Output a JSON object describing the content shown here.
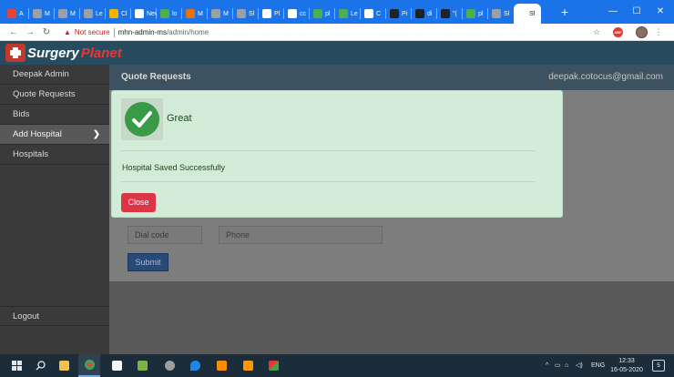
{
  "browser": {
    "tabs": [
      {
        "label": "A",
        "color": "#ea4335"
      },
      {
        "label": "M",
        "color": "#9aa0a6"
      },
      {
        "label": "M",
        "color": "#9aa0a6"
      },
      {
        "label": "Le",
        "color": "#9aa0a6"
      },
      {
        "label": "Cl",
        "color": "#f4b400"
      },
      {
        "label": "New T",
        "color": "#ffffff"
      },
      {
        "label": "lo",
        "color": "#4caf50"
      },
      {
        "label": "M",
        "color": "#e8710a"
      },
      {
        "label": "M",
        "color": "#9aa0a6"
      },
      {
        "label": "Sl",
        "color": "#9aa0a6"
      },
      {
        "label": "Pl",
        "color": "#ffffff"
      },
      {
        "label": "cc",
        "color": "#ffffff"
      },
      {
        "label": "pl",
        "color": "#4caf50"
      },
      {
        "label": "Le",
        "color": "#4caf50"
      },
      {
        "label": "C",
        "color": "#ffffff"
      },
      {
        "label": "Pi",
        "color": "#202124"
      },
      {
        "label": "di",
        "color": "#202124"
      },
      {
        "label": "\"(",
        "color": "#202124"
      },
      {
        "label": "pl",
        "color": "#4caf50"
      },
      {
        "label": "Sl",
        "color": "#9aa0a6"
      },
      {
        "label": "Sl",
        "color": "#ffffff",
        "active": true
      }
    ],
    "new_tab_symbol": "+",
    "window_controls": {
      "minimize": "—",
      "maximize": "☐",
      "close": "✕"
    },
    "address": {
      "security_label": "Not secure",
      "url_host": "mhn-admin-ms",
      "url_path": "/admin/home"
    },
    "extension_label": "ABP"
  },
  "app": {
    "brand_word1": "Surgery",
    "brand_word2": "Planet",
    "sidebar": {
      "items": [
        {
          "label": "Deepak Admin"
        },
        {
          "label": "Quote Requests"
        },
        {
          "label": "Bids"
        },
        {
          "label": "Add Hospital",
          "active": true,
          "chevron": "❯"
        },
        {
          "label": "Hospitals"
        }
      ],
      "logout_label": "Logout"
    },
    "main": {
      "title": "Quote Requests",
      "user_email": "deepak.cotocus@gmail.com",
      "form": {
        "dial_code_placeholder": "Dial code",
        "phone_placeholder": "Phone",
        "submit_label": "Submit"
      }
    },
    "modal": {
      "title": "Great",
      "message": "Hospital Saved Successfully",
      "close_label": "Close"
    }
  },
  "taskbar": {
    "language": "ENG",
    "time": "12:33",
    "date": "16-05-2020",
    "notification_count": "5"
  }
}
